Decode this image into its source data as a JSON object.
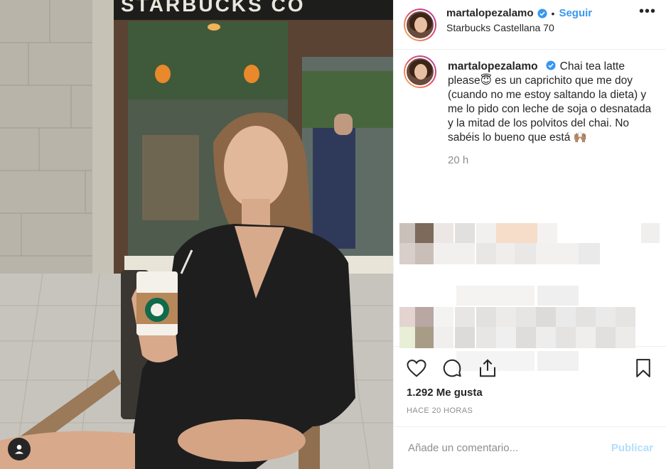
{
  "post": {
    "author": "martalopezalamo",
    "location": "Starbucks Castellana 70",
    "follow_label": "Seguir",
    "more_label": "•••",
    "caption_text": "Chai tea latte please😇 es un caprichito que me doy (cuando no me estoy saltando la dieta) y me lo pido con leche de soja o desnatada y la mitad de los polvitos del chai. No sabéis lo bueno que está 🙌🏽",
    "caption_age": "20 h",
    "likes": "1.292 Me gusta",
    "timestamp": "HACE 20 HORAS",
    "comment_placeholder": "Añade un comentario...",
    "publish_label": "Publicar"
  },
  "photo": {
    "storefront_sign": "STARBUCKS CO"
  },
  "icons": [
    "verified-badge-icon",
    "heart-icon",
    "comment-icon",
    "share-icon",
    "bookmark-icon",
    "user-tag-icon",
    "more-options-icon"
  ],
  "colors": {
    "link_blue": "#3897f0",
    "publish_disabled": "#b2dffc",
    "muted_text": "#8e8e8e",
    "border": "#efefef"
  }
}
